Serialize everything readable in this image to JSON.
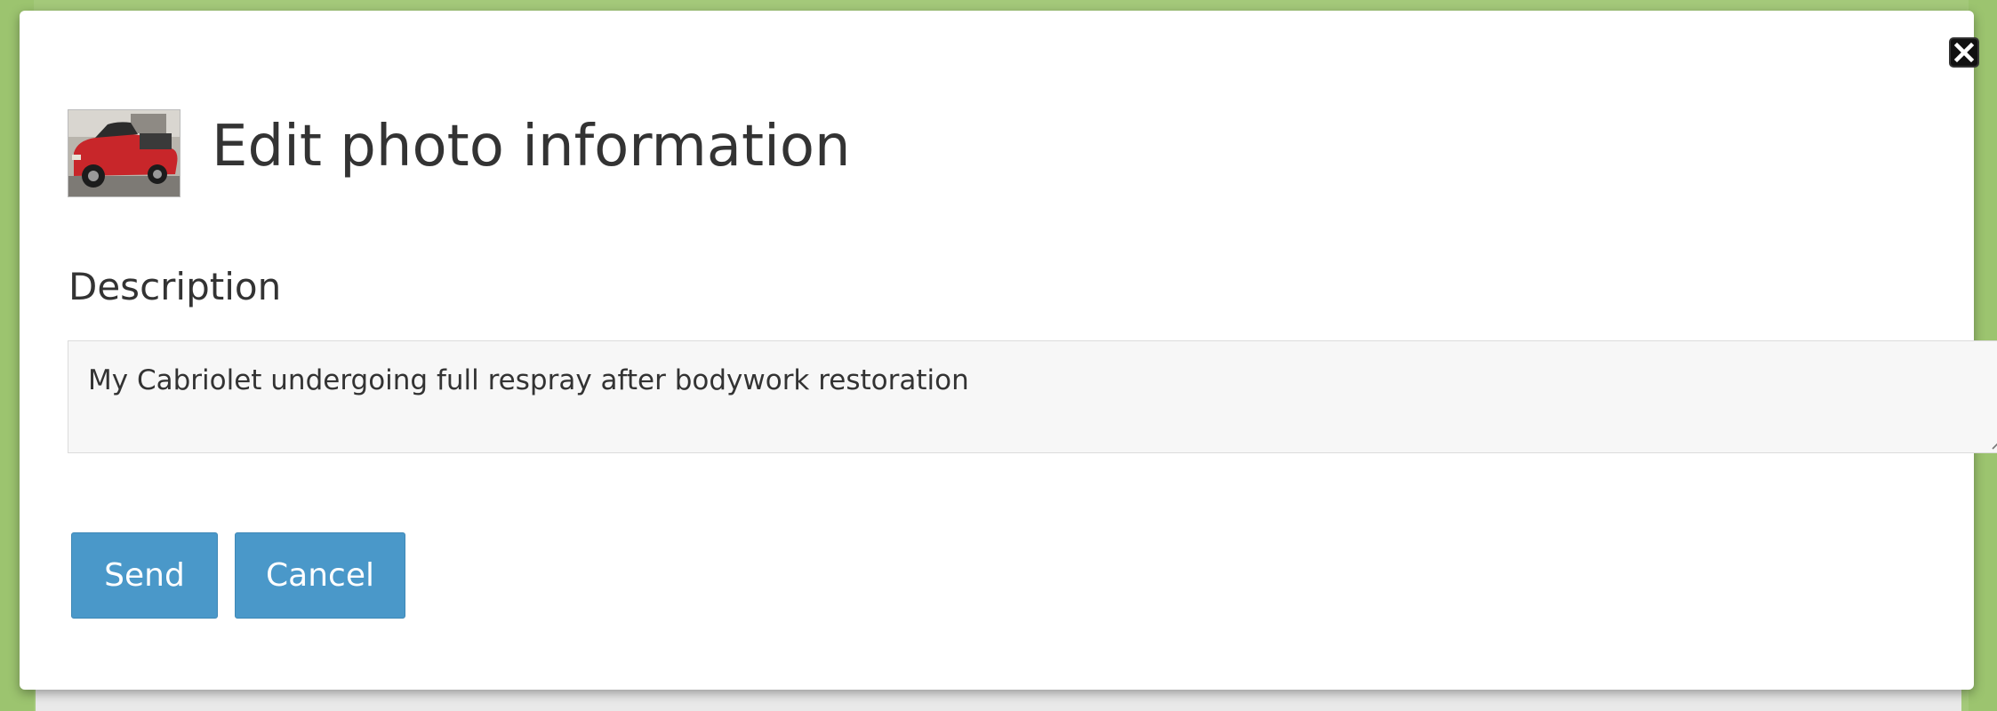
{
  "dialog": {
    "title": "Edit photo information",
    "close_icon": "close-icon",
    "thumbnail_icon": "car-photo-thumbnail"
  },
  "form": {
    "description_label": "Description",
    "description_value": "My Cabriolet undergoing full respray after bodywork restoration"
  },
  "buttons": {
    "send_label": "Send",
    "cancel_label": "Cancel"
  },
  "colors": {
    "button": "#4a98c9",
    "backdrop": "#9cc46f",
    "title_text": "#333333",
    "input_background": "#f7f7f7"
  }
}
